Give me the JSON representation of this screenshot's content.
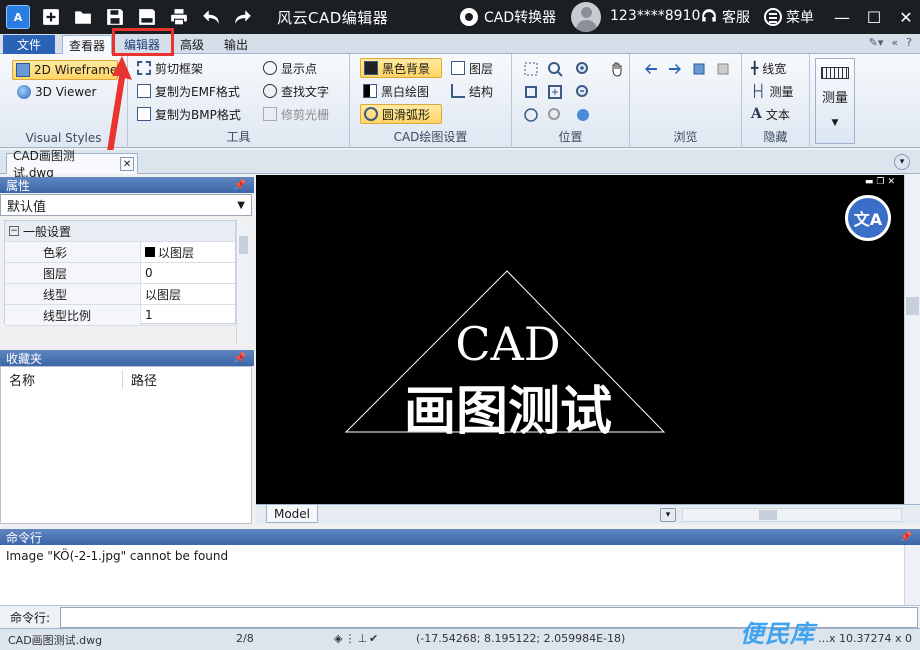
{
  "titlebar": {
    "app_logo": "A",
    "title": "风云CAD编辑器",
    "converter_label": "CAD转换器",
    "user_phone": "123****8910",
    "support_label": "客服",
    "menu_label": "菜单"
  },
  "ribbon_tabs": [
    "文件",
    "查看器",
    "编辑器",
    "高级",
    "输出"
  ],
  "ribbon": {
    "visual_styles": {
      "label": "Visual Styles",
      "wireframe": "2D Wireframe",
      "viewer3d": "3D Viewer"
    },
    "tools": {
      "label": "工具",
      "clip_frame": "剪切框架",
      "copy_emf": "复制为EMF格式",
      "copy_bmp": "复制为BMP格式",
      "show_points": "显示点",
      "find_text": "查找文字",
      "trim_raster": "修剪光栅"
    },
    "cad_settings": {
      "label": "CAD绘图设置",
      "black_bg": "黑色背景",
      "bw_draw": "黑白绘图",
      "smooth_arc": "圆滑弧形",
      "layers": "图层",
      "structure": "结构"
    },
    "position": {
      "label": "位置"
    },
    "browse": {
      "label": "浏览"
    },
    "hide": {
      "label": "隐藏",
      "line_width": "线宽",
      "measure": "测量",
      "text": "文本"
    },
    "measure_big": "测量"
  },
  "document": {
    "tab_name": "CAD画图测试.dwg"
  },
  "properties": {
    "header": "属性",
    "selector": "默认值",
    "category": "一般设置",
    "rows": [
      {
        "key": "色彩",
        "value": "以图层"
      },
      {
        "key": "图层",
        "value": "0"
      },
      {
        "key": "线型",
        "value": "以图层"
      },
      {
        "key": "线型比例",
        "value": "1"
      }
    ]
  },
  "favorites": {
    "header": "收藏夹",
    "col_name": "名称",
    "col_path": "路径"
  },
  "drawing": {
    "line1": "CAD",
    "line2": "画图测试",
    "model_tab": "Model"
  },
  "command": {
    "header": "命令行",
    "output": "Image \"KÖ(-2-1.jpg\" cannot be found",
    "input_label": "命令行:",
    "input_value": ""
  },
  "status": {
    "file": "CAD画图测试.dwg",
    "page": "2/8",
    "coords": "(-17.54268; 8.195122; 2.059984E-18)",
    "size": "…x 10.37274 x 0"
  },
  "watermark": "便民库",
  "colors": {
    "title_bg": "#1b1f24",
    "accent": "#2a62b8",
    "highlight": "#e8332f",
    "canvas_bg": "#000000"
  }
}
